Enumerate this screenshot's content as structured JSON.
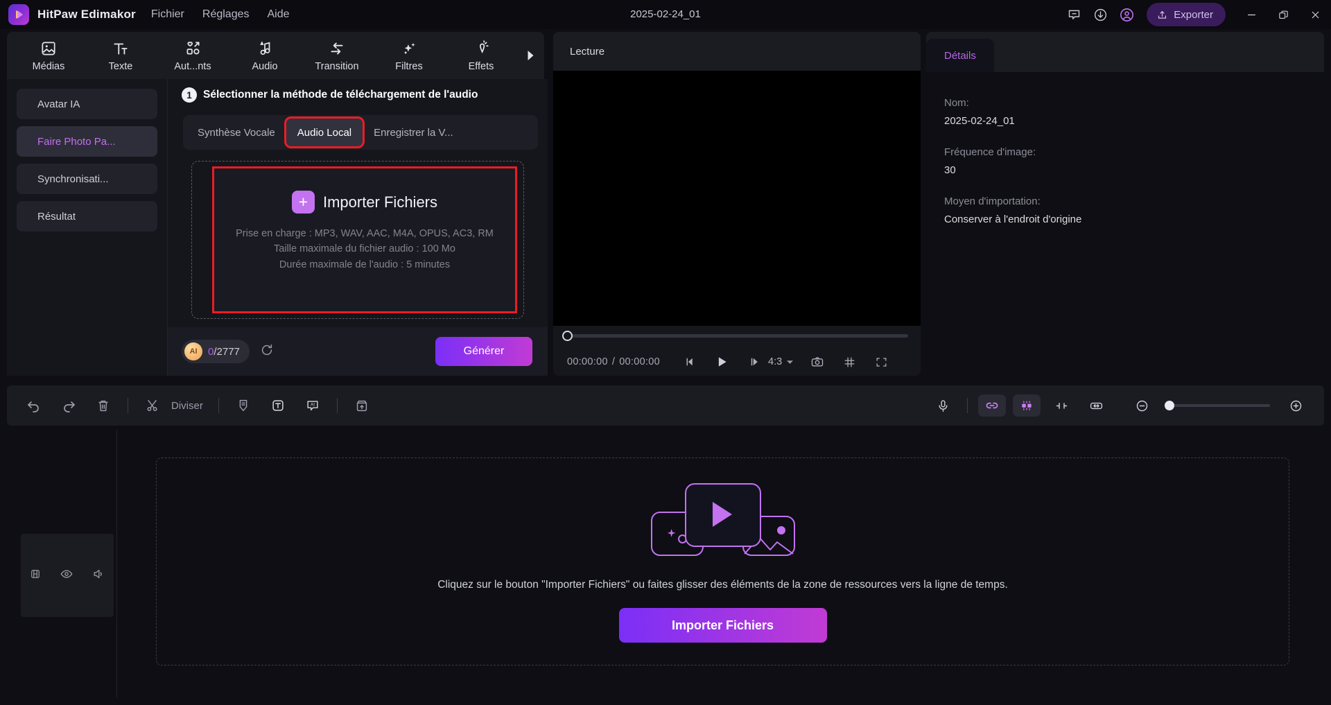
{
  "titlebar": {
    "app_name": "HitPaw Edimakor",
    "menus": [
      {
        "label": "Fichier"
      },
      {
        "label": "Réglages"
      },
      {
        "label": "Aide"
      }
    ],
    "document_title": "2025-02-24_01",
    "export_label": "Exporter",
    "icons": {
      "feedback": "feedback-icon",
      "download": "download-icon",
      "account": "account-icon",
      "minimize": "minimize-icon",
      "maximize": "maximize-icon",
      "close": "close-icon"
    }
  },
  "toolbar": {
    "items": [
      {
        "label": "Médias",
        "icon": "media-icon"
      },
      {
        "label": "Texte",
        "icon": "text-icon"
      },
      {
        "label": "Aut...nts",
        "icon": "stickers-icon"
      },
      {
        "label": "Audio",
        "icon": "audio-icon"
      },
      {
        "label": "Transition",
        "icon": "transition-icon"
      },
      {
        "label": "Filtres",
        "icon": "filters-icon"
      },
      {
        "label": "Effets",
        "icon": "effects-icon"
      }
    ],
    "more_arrow": "chevron-right-icon"
  },
  "sidebar": {
    "items": [
      {
        "label": "Avatar IA",
        "active": false
      },
      {
        "label": "Faire Photo Pa...",
        "active": true
      },
      {
        "label": "Synchronisati...",
        "active": false
      },
      {
        "label": "Résultat",
        "active": false
      }
    ]
  },
  "ai_panel": {
    "step_number": "1",
    "step_title": "Sélectionner la méthode de téléchargement de l'audio",
    "tabs": [
      {
        "label": "Synthèse Vocale",
        "selected": false
      },
      {
        "label": "Audio Local",
        "selected": true
      },
      {
        "label": "Enregistrer la V...",
        "selected": false
      }
    ],
    "dropzone": {
      "import_label": "Importer Fichiers",
      "plus_icon": "plus-icon",
      "supported": "Prise en charge : MP3, WAV, AAC, M4A, OPUS, AC3, RM",
      "max_size": "Taille maximale du fichier audio : 100 Mo",
      "max_duration": "Durée maximale de l'audio : 5 minutes"
    },
    "credits": {
      "badge": "AI",
      "used": "0",
      "separator": "/",
      "total": "2777",
      "refresh_icon": "refresh-icon"
    },
    "generate_label": "Générer"
  },
  "preview": {
    "title": "Lecture",
    "current_time": "00:00:00",
    "time_separator": "/",
    "total_time": "00:00:00",
    "aspect_ratio": "4:3",
    "icons": {
      "prev_frame": "previous-frame-icon",
      "play": "play-icon",
      "next_frame": "next-frame-icon",
      "ratio_caret": "chevron-down-icon",
      "snapshot": "camera-icon",
      "grid": "grid-icon",
      "fullscreen": "fullscreen-icon"
    }
  },
  "details": {
    "tab_label": "Détails",
    "fields": [
      {
        "label": "Nom:",
        "value": "2025-02-24_01"
      },
      {
        "label": "Fréquence d'image:",
        "value": "30"
      },
      {
        "label": "Moyen d'importation:",
        "value": "Conserver à l'endroit d'origine"
      }
    ]
  },
  "edit_toolbar": {
    "undo_icon": "undo-icon",
    "redo_icon": "redo-icon",
    "delete_icon": "trash-icon",
    "split_icon": "scissors-icon",
    "split_label": "Diviser",
    "marker_icon": "marker-icon",
    "text_icon": "text-box-icon",
    "ai_icon": "ai-caption-icon",
    "export_clip_icon": "export-clip-icon",
    "mic_icon": "microphone-icon",
    "link_icon": "link-clips-icon",
    "detach_icon": "detach-audio-icon",
    "crop_icon": "crop-icon",
    "fit_icon": "fit-width-icon",
    "zoom_out_icon": "zoom-out-icon",
    "zoom_in_icon": "zoom-in-icon"
  },
  "timeline": {
    "track_icons": {
      "lock": "film-lock-icon",
      "eye": "visibility-icon",
      "volume": "volume-icon"
    },
    "placeholder_icon": "media-placeholder-icon",
    "message": "Cliquez sur le bouton \"Importer Fichiers\" ou faites glisser des éléments de la zone de ressources vers la ligne de temps.",
    "import_button": "Importer Fichiers"
  },
  "colors": {
    "accent_purple": "#a862e8",
    "gradient_start": "#7b2ff7",
    "gradient_end": "#c13bd4",
    "highlight_red": "#ec1c24",
    "panel_bg": "#15151c",
    "window_bg": "#0e0e14"
  }
}
